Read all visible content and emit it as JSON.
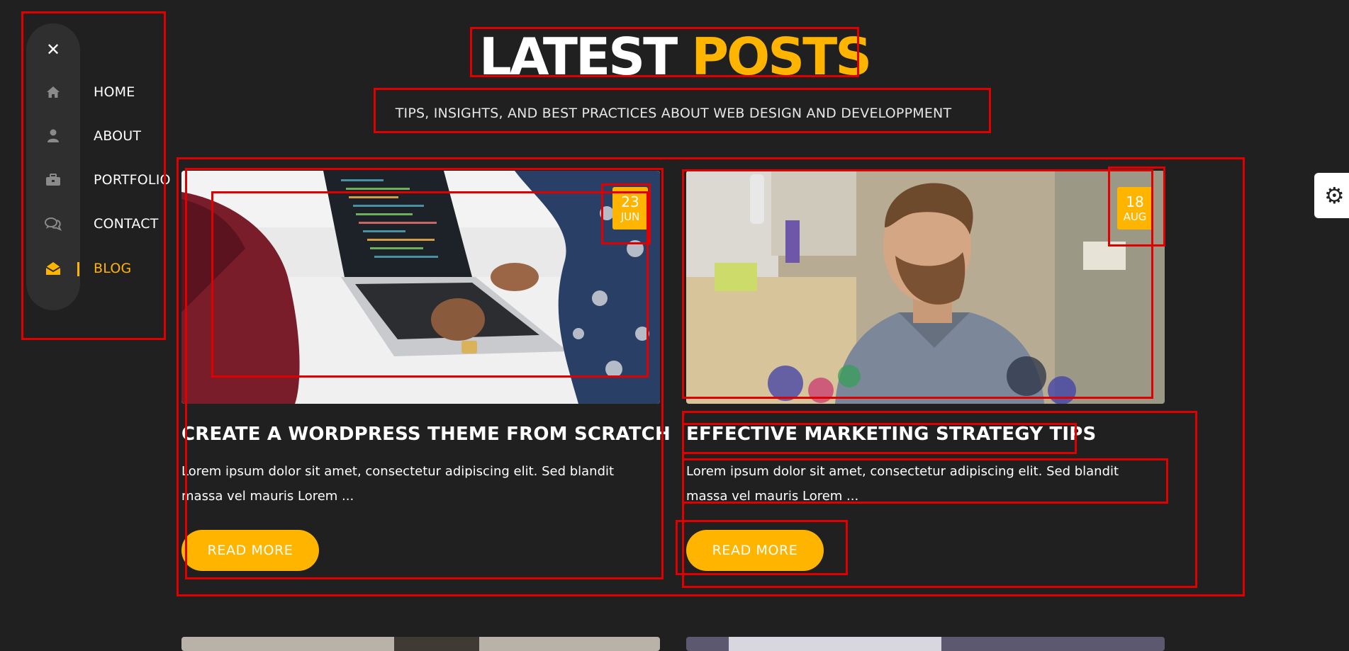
{
  "nav": {
    "close_icon": "close-icon",
    "items": [
      {
        "label": "HOME",
        "icon": "home-icon"
      },
      {
        "label": "ABOUT",
        "icon": "user-icon"
      },
      {
        "label": "PORTFOLIO",
        "icon": "briefcase-icon"
      },
      {
        "label": "CONTACT",
        "icon": "chat-icon"
      },
      {
        "label": "BLOG",
        "icon": "envelope-open-icon",
        "active": true
      }
    ]
  },
  "header": {
    "title_part1": "LATEST",
    "title_part2": "POSTS",
    "subtitle": "TIPS, INSIGHTS, AND BEST PRACTICES ABOUT WEB DESIGN AND DEVELOPPMENT"
  },
  "posts": [
    {
      "day": "23",
      "month": "JUN",
      "title": "CREATE A WORDPRESS THEME FROM SCRATCH",
      "excerpt": "Lorem ipsum dolor sit amet, consectetur adipiscing elit. Sed blandit massa vel mauris Lorem ...",
      "button": "READ MORE"
    },
    {
      "day": "18",
      "month": "AUG",
      "title": "EFFECTIVE MARKETING STRATEGY TIPS",
      "excerpt": "Lorem ipsum dolor sit amet, consectetur adipiscing elit. Sed blandit massa vel mauris Lorem ...",
      "button": "READ MORE"
    }
  ],
  "colors": {
    "background": "#202020",
    "accent": "#ffb400",
    "nav_pill": "#2f2f2f",
    "annotation": "#e00000"
  }
}
